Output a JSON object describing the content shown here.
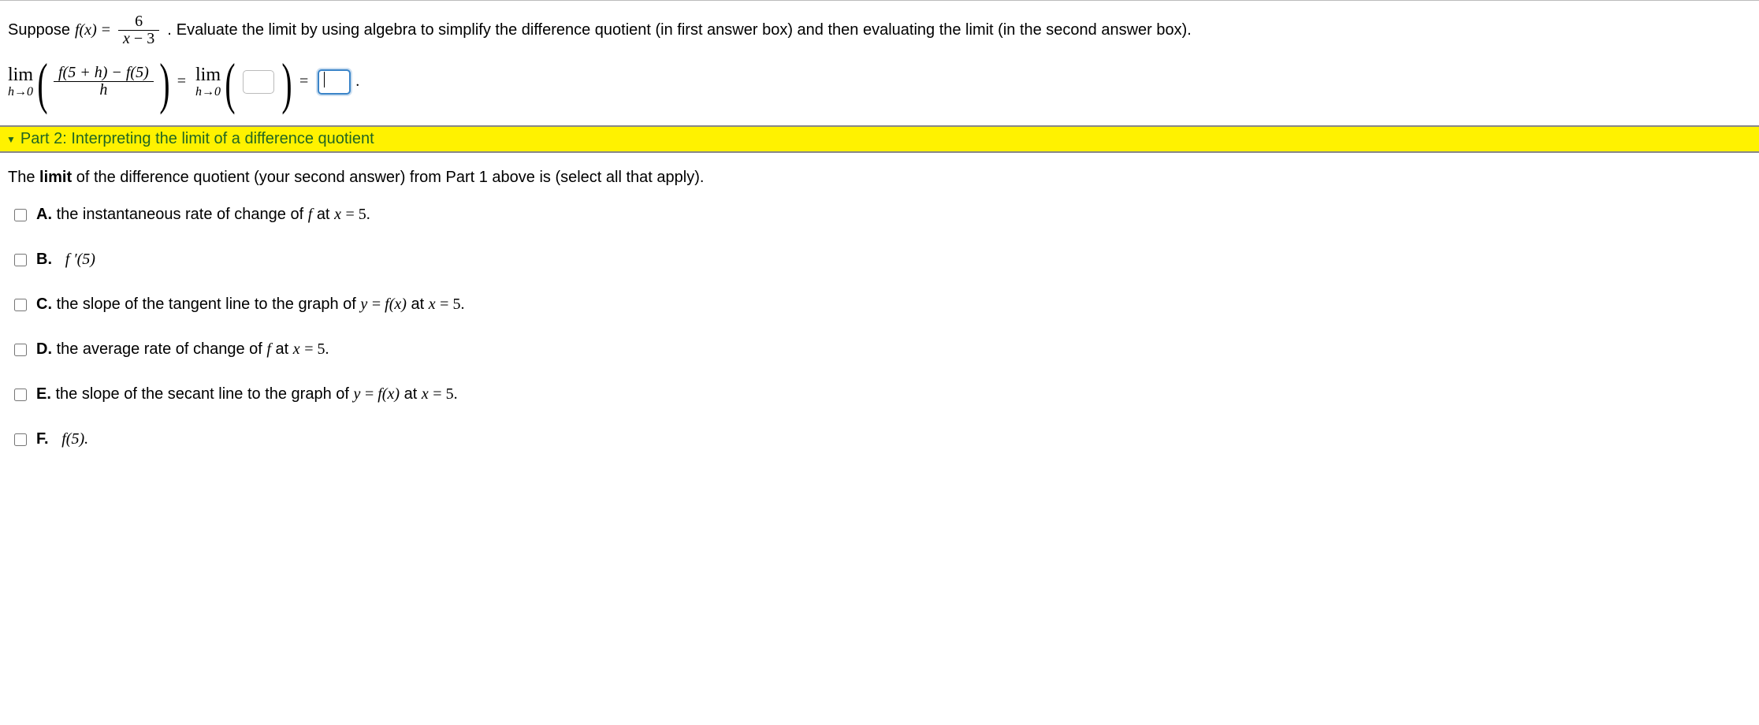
{
  "part1": {
    "suppose_prefix": "Suppose ",
    "fx_label": "f(x)",
    "equals": " = ",
    "frac_num": "6",
    "frac_den_left": "x",
    "frac_den_op": " − ",
    "frac_den_right": "3",
    "period_after_frac": " . ",
    "instruction": "Evaluate the limit by using algebra to simplify the difference quotient (in first answer box) and then evaluating the limit (in the second answer box).",
    "lim_word": "lim",
    "lim_sub": "h→0",
    "dq_num": "f(5 + h) − f(5)",
    "dq_den": "h",
    "eq_sign": " = ",
    "final_period": " ."
  },
  "part2": {
    "header": "Part 2: Interpreting the limit of a difference quotient",
    "prompt_pre": "The ",
    "prompt_bold": "limit",
    "prompt_post": " of the difference quotient (your second answer) from Part 1 above is (select all that apply).",
    "options": {
      "A_label": "A.",
      "A_text_pre": " the instantaneous rate of change of ",
      "A_f": "f",
      "A_text_mid": " at ",
      "A_x": "x",
      "A_eq": " = ",
      "A_val": "5.",
      "B_label": "B.",
      "B_expr": "f ′(5)",
      "C_label": "C.",
      "C_text_pre": " the slope of the tangent line to the graph of ",
      "C_y": "y",
      "C_eq1": " = ",
      "C_fx": "f(x)",
      "C_at": " at ",
      "C_x": "x",
      "C_eq2": " = ",
      "C_val": "5.",
      "D_label": "D.",
      "D_text_pre": " the average rate of change of ",
      "D_f": "f",
      "D_at": " at ",
      "D_x": "x",
      "D_eq": " = ",
      "D_val": "5.",
      "E_label": "E.",
      "E_text_pre": " the slope of the secant line to the graph of ",
      "E_y": "y",
      "E_eq1": " = ",
      "E_fx": "f(x)",
      "E_at": " at ",
      "E_x": "x",
      "E_eq2": " = ",
      "E_val": "5.",
      "F_label": "F.",
      "F_expr": "f(5)."
    }
  }
}
